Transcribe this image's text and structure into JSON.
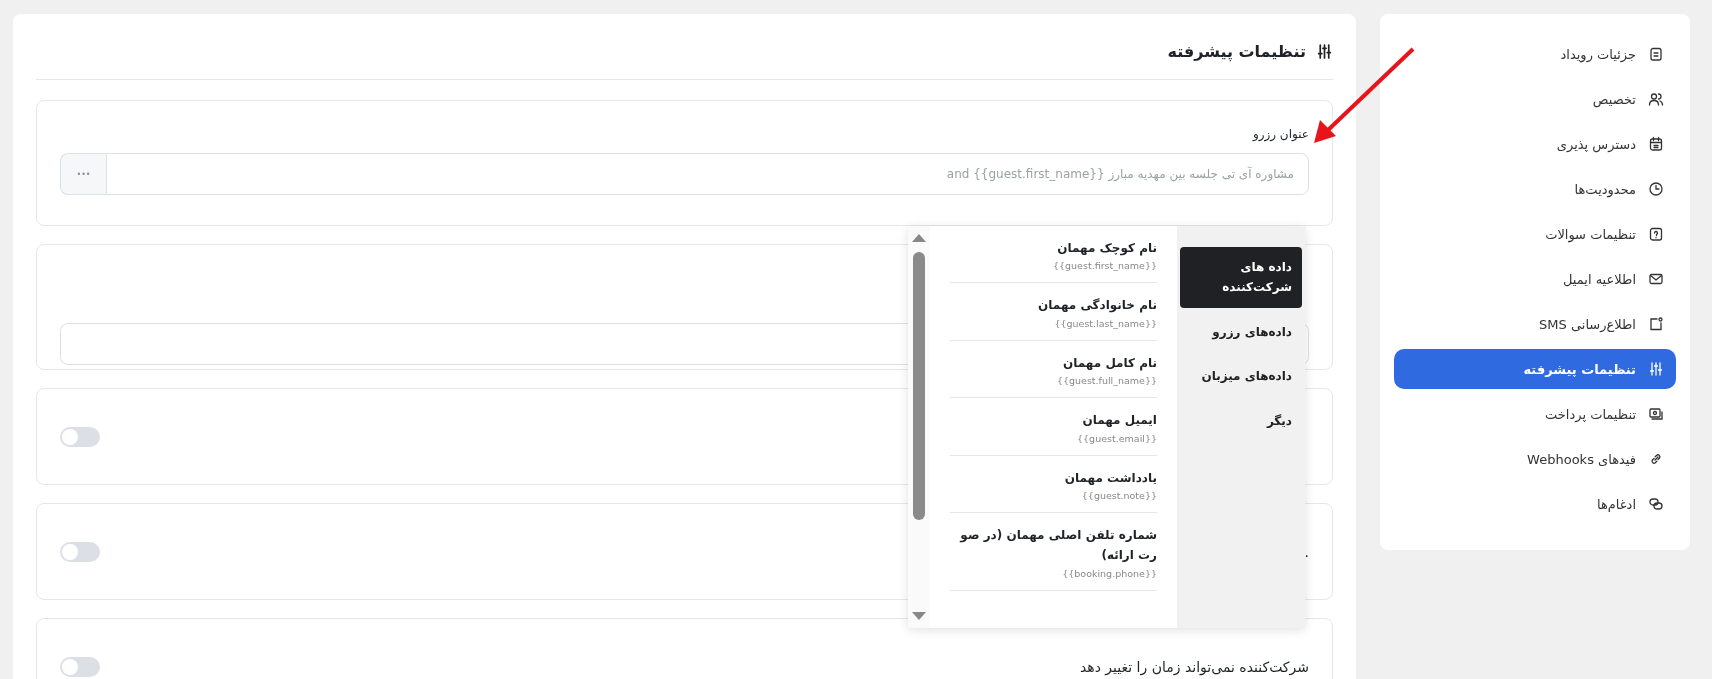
{
  "sidebar": {
    "items": [
      {
        "label": "جزئیات رویداد",
        "selected": false
      },
      {
        "label": "تخصیص",
        "selected": false
      },
      {
        "label": "دسترس پذیری",
        "selected": false
      },
      {
        "label": "محدودیت‌ها",
        "selected": false
      },
      {
        "label": "تنظیمات سوالات",
        "selected": false
      },
      {
        "label": "اطلاعیه ایمیل",
        "selected": false
      },
      {
        "label": "اطلاع‌رسانی SMS",
        "selected": false
      },
      {
        "label": "تنظیمات پیشرفته",
        "selected": true
      },
      {
        "label": "تنظیمات پرداخت",
        "selected": false
      },
      {
        "label": "فیدهای Webhooks",
        "selected": false
      },
      {
        "label": "ادغام‌ها",
        "selected": false
      }
    ]
  },
  "main": {
    "title": "تنظیمات پیشرفته",
    "cards": [
      {
        "kind": "input",
        "label": "عنوان رزرو",
        "value": "مشاوره آی تی جلسه بین مهدیه مبارز {{guest.first_name}} and",
        "button": "•••"
      },
      {
        "kind": "input"
      },
      {
        "kind": "toggle",
        "on": false
      },
      {
        "kind": "toggle",
        "on": false,
        "label": "."
      },
      {
        "kind": "toggle",
        "on": false,
        "label": "شرکت‌کننده نمی‌تواند زمان را تغییر دهد"
      }
    ]
  },
  "variable_menu": {
    "categories": [
      {
        "label": "داده های شرکت‌کننده",
        "selected": true
      },
      {
        "label": "داده‌های رزرو",
        "selected": false
      },
      {
        "label": "داده‌های میزبان",
        "selected": false
      },
      {
        "label": "دیگر",
        "selected": false
      }
    ],
    "variables": [
      {
        "name": "نام کوچک مهمان",
        "token": "{{guest.first_name}}"
      },
      {
        "name": "نام خانوادگی مهمان",
        "token": "{{guest.last_name}}"
      },
      {
        "name": "نام کامل مهمان",
        "token": "{{guest.full_name}}"
      },
      {
        "name": "ایمیل مهمان",
        "token": "{{guest.email}}"
      },
      {
        "name": "یادداشت مهمان",
        "token": "{{guest.note}}"
      },
      {
        "name": "شماره تلفن اصلی مهمان (در صو رت ارائه)",
        "token": "{{booking.phone}}"
      }
    ]
  }
}
